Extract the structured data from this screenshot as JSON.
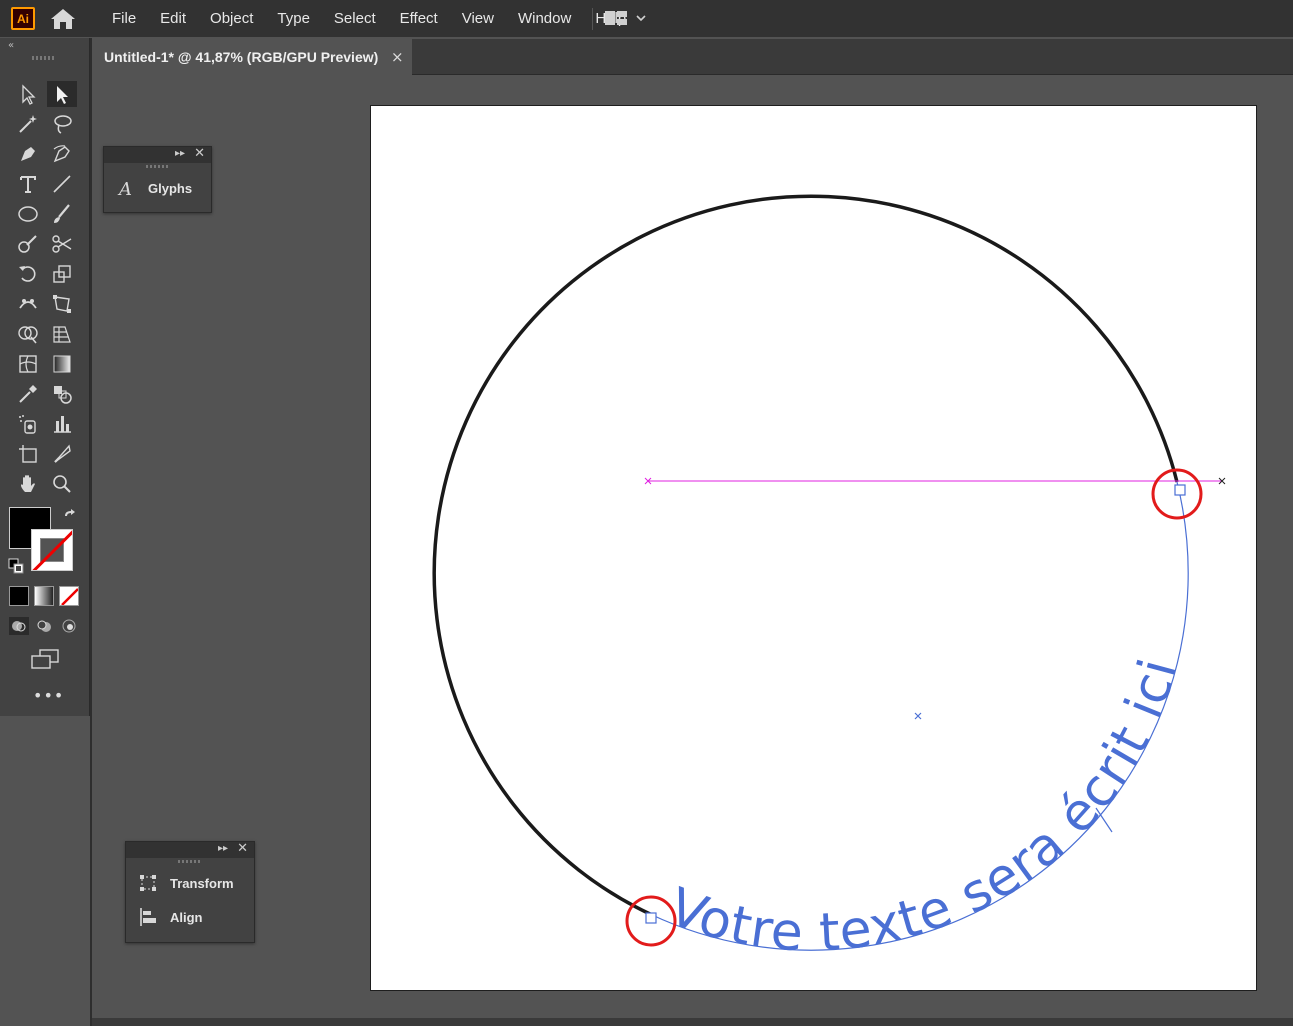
{
  "app": {
    "logo_text": "Ai",
    "accent": "#ff9a00"
  },
  "menu": {
    "items": [
      "File",
      "Edit",
      "Object",
      "Type",
      "Select",
      "Effect",
      "View",
      "Window",
      "Help"
    ]
  },
  "document_tab": {
    "title": "Untitled-1* @ 41,87% (RGB/GPU Preview)",
    "close_glyph": "×"
  },
  "toolbar": {
    "collapse_glyph": "«",
    "more_glyph": "•••",
    "fill_color": "#000000",
    "stroke_color": "none"
  },
  "panels": {
    "glyphs": {
      "label": "Glyphs",
      "icon": "glyphs-icon"
    },
    "transform_align": {
      "items": [
        {
          "label": "Transform",
          "icon": "transform-icon"
        },
        {
          "label": "Align",
          "icon": "align-icon"
        }
      ]
    }
  },
  "canvas": {
    "path_text": "Votre texte sera écrit ici",
    "text_color": "#4a6fd4",
    "guide_color": "#e020e0",
    "highlight_color": "#e21b1b",
    "circle_stroke": "#1a1a1a"
  }
}
